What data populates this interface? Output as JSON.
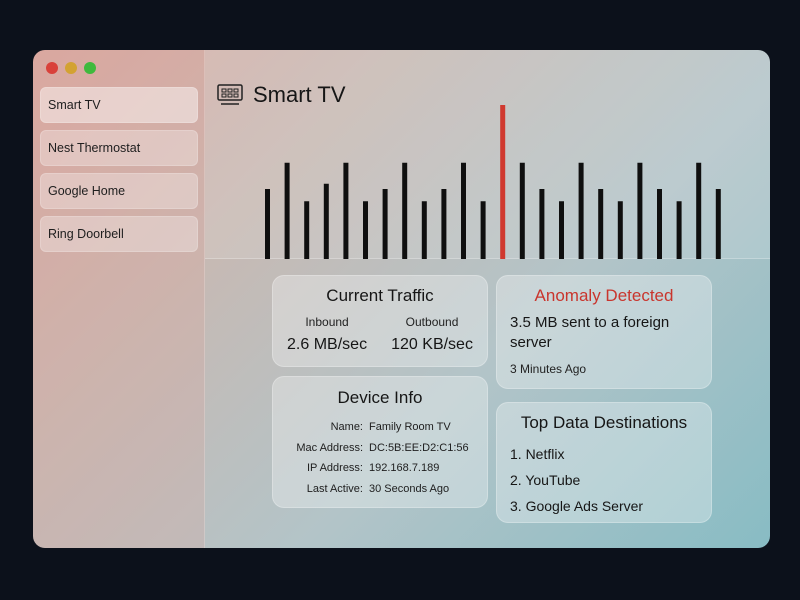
{
  "window": {
    "controls": {
      "close_color": "#d9413a",
      "minimize_color": "#d3a232",
      "zoom_color": "#3fba3d"
    }
  },
  "sidebar": {
    "items": [
      {
        "label": "Smart TV",
        "active": true
      },
      {
        "label": "Nest Thermostat",
        "active": false
      },
      {
        "label": "Google Home",
        "active": false
      },
      {
        "label": "Ring Doorbell",
        "active": false
      }
    ]
  },
  "header": {
    "icon": "tv-icon",
    "title": "Smart TV"
  },
  "chart_data": {
    "type": "bar",
    "values": [
      4,
      5.5,
      3.3,
      4.3,
      5.5,
      3.3,
      4,
      5.5,
      3.3,
      4,
      5.5,
      3.3,
      8.8,
      5.5,
      4,
      3.3,
      5.5,
      4,
      3.3,
      5.5,
      4,
      3.3,
      5.5,
      4
    ],
    "highlight_index": 12,
    "bar_color": "#0f0f0f",
    "highlight_color": "#d0392f",
    "ylim": [
      0,
      8.8
    ]
  },
  "cards": {
    "traffic": {
      "title": "Current Traffic",
      "inbound_label": "Inbound",
      "inbound_value": "2.6 MB/sec",
      "outbound_label": "Outbound",
      "outbound_value": "120 KB/sec"
    },
    "anomaly": {
      "title": "Anomaly Detected",
      "message": "3.5 MB sent to a foreign server",
      "time": "3 Minutes Ago",
      "accent_color": "#c9352d"
    },
    "device": {
      "title": "Device Info",
      "rows": [
        {
          "label": "Name:",
          "value": "Family Room TV"
        },
        {
          "label": "Mac Address:",
          "value": "DC:5B:EE:D2:C1:56"
        },
        {
          "label": "IP Address:",
          "value": "192.168.7.189"
        },
        {
          "label": "Last Active:",
          "value": "30 Seconds Ago"
        }
      ]
    },
    "destinations": {
      "title": "Top Data Destinations",
      "items": [
        "1. Netflix",
        "2. YouTube",
        "3. Google Ads Server"
      ]
    }
  }
}
